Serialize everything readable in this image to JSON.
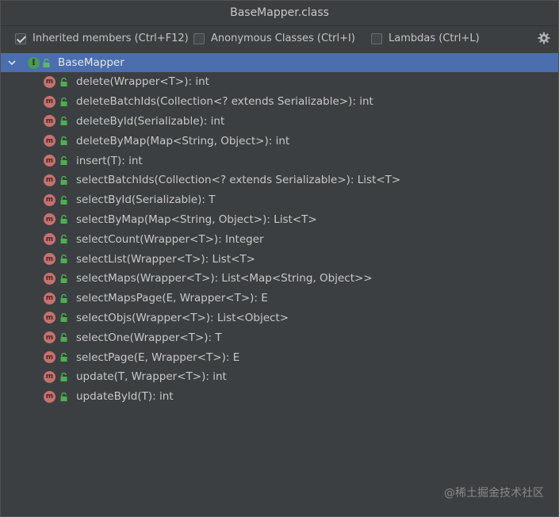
{
  "window": {
    "title": "BaseMapper.class"
  },
  "toolbar": {
    "inherited": {
      "label": "Inherited members (Ctrl+F12)",
      "checked": true
    },
    "anonymous": {
      "label": "Anonymous Classes (Ctrl+I)",
      "checked": false
    },
    "lambdas": {
      "label": "Lambdas (Ctrl+L)",
      "checked": false
    }
  },
  "tree": {
    "root": {
      "label": "BaseMapper",
      "icon": "interface-icon"
    },
    "methods": [
      "delete(Wrapper<T>): int",
      "deleteBatchIds(Collection<? extends Serializable>): int",
      "deleteById(Serializable): int",
      "deleteByMap(Map<String, Object>): int",
      "insert(T): int",
      "selectBatchIds(Collection<? extends Serializable>): List<T>",
      "selectById(Serializable): T",
      "selectByMap(Map<String, Object>): List<T>",
      "selectCount(Wrapper<T>): Integer",
      "selectList(Wrapper<T>): List<T>",
      "selectMaps(Wrapper<T>): List<Map<String, Object>>",
      "selectMapsPage(E, Wrapper<T>): E",
      "selectObjs(Wrapper<T>): List<Object>",
      "selectOne(Wrapper<T>): T",
      "selectPage(E, Wrapper<T>): E",
      "update(T, Wrapper<T>): int",
      "updateById(T): int"
    ]
  },
  "colors": {
    "background": "#3c3f41",
    "selection": "#4b6eaf",
    "method_icon": "#c5726f",
    "interface_icon": "#499c54",
    "lock": "#4caf50"
  },
  "watermark": "@稀土掘金技术社区"
}
